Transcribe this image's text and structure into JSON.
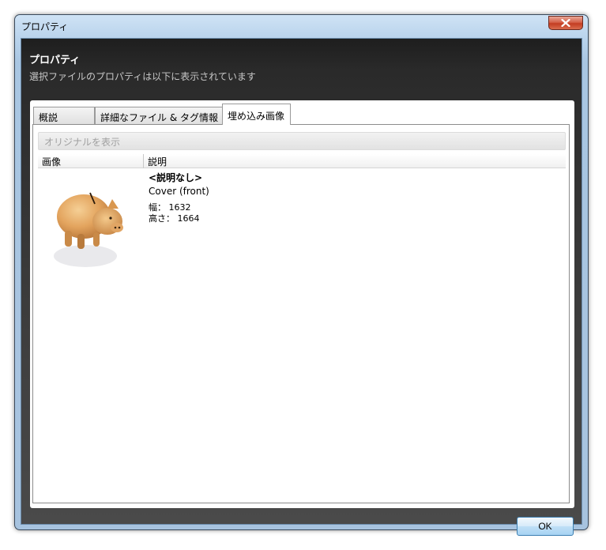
{
  "window": {
    "title": "プロパティ"
  },
  "header": {
    "title": "プロパティ",
    "subtitle": "選択ファイルのプロパティは以下に表示されています"
  },
  "tabs": [
    {
      "label": "概説",
      "active": false
    },
    {
      "label": "詳細なファイル & タグ情報",
      "active": false
    },
    {
      "label": "埋め込み画像",
      "active": true
    }
  ],
  "content": {
    "show_original_label": "オリジナルを表示",
    "columns": [
      "画像",
      "説明"
    ],
    "rows": [
      {
        "image_icon": "piggy-bank-image",
        "description_title": "<説明なし>",
        "type": "Cover (front)",
        "width_label": "幅：",
        "width": "1632",
        "height_label": "高さ：",
        "height": "1664"
      }
    ]
  },
  "footer": {
    "ok_label": "OK"
  },
  "icons": {
    "close": "close-icon"
  },
  "colors": {
    "accent": "#3c7fb1",
    "close_button": "#c43d22"
  }
}
